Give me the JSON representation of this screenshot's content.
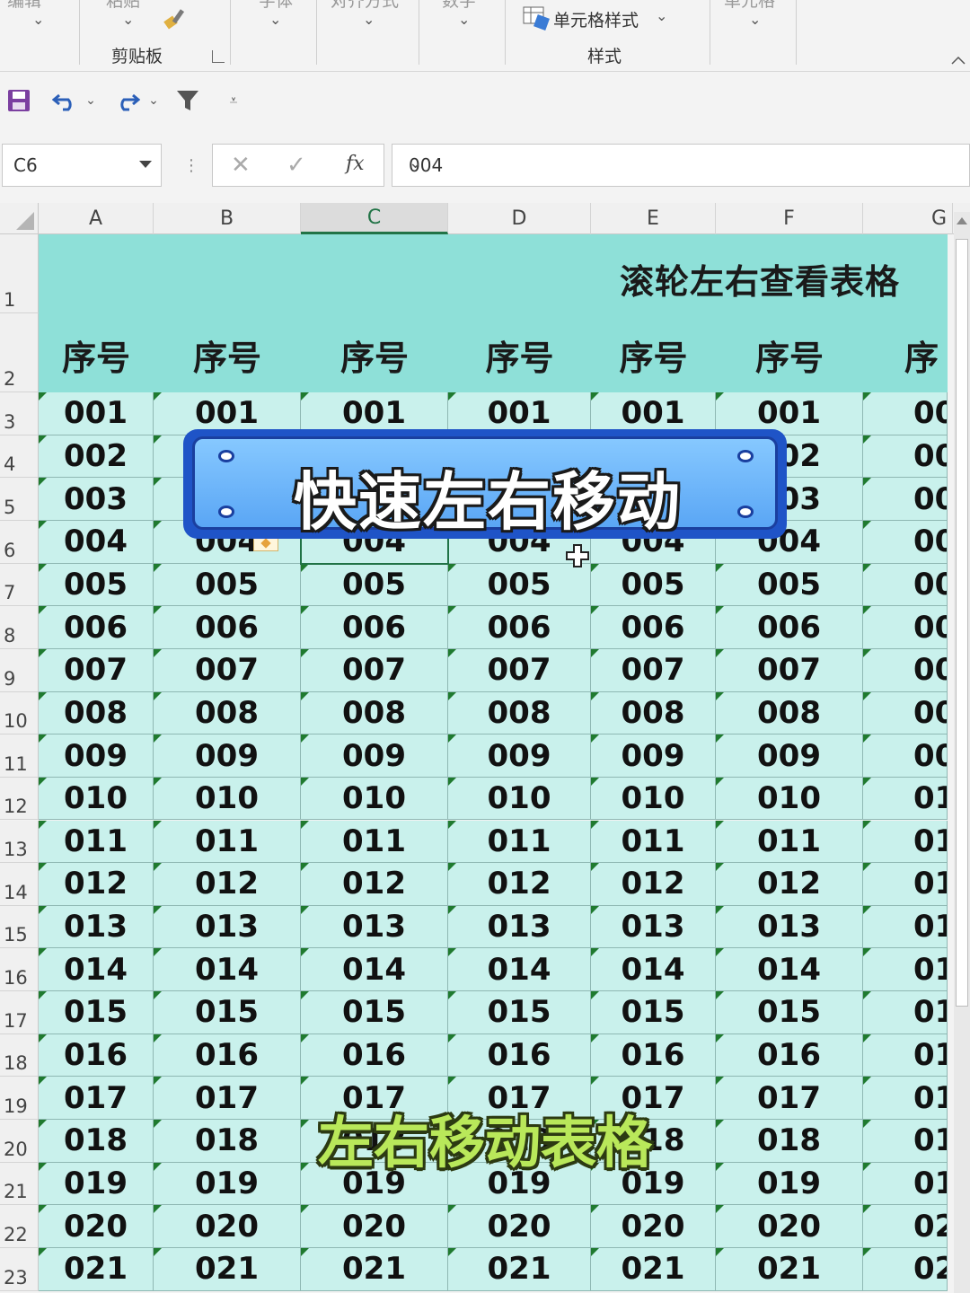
{
  "ribbon": {
    "partial_labels": [
      "编辑",
      "粘贴",
      "字体",
      "对齐方式",
      "数字",
      "单元格"
    ],
    "cell_style": "单元格样式",
    "clipboard": "剪贴板",
    "styles": "样式"
  },
  "namebox": {
    "value": "C6"
  },
  "formula_bar": {
    "fx": "fx",
    "value": "004"
  },
  "columns": [
    "A",
    "B",
    "C",
    "D",
    "E",
    "F",
    "G"
  ],
  "rows": [
    "1",
    "2",
    "3",
    "4",
    "5",
    "6",
    "7",
    "8",
    "9",
    "10",
    "11",
    "12",
    "13",
    "14",
    "15",
    "16",
    "17",
    "18",
    "19",
    "20",
    "21",
    "22",
    "23"
  ],
  "sheet": {
    "title": "滚轮左右查看表格",
    "header": [
      "序号",
      "序号",
      "序号",
      "序号",
      "序号",
      "序号",
      "序"
    ],
    "values": [
      "001",
      "002",
      "003",
      "004",
      "005",
      "006",
      "007",
      "008",
      "009",
      "010",
      "011",
      "012",
      "013",
      "014",
      "015",
      "016",
      "017",
      "018",
      "019",
      "020",
      "021"
    ]
  },
  "overlay": {
    "banner": "快速左右移动",
    "subtitle": "左右移动表格"
  },
  "colors": {
    "header_band": "#8ee0d8",
    "cell_bg": "#c9f1ec",
    "banner": "#1f54c7",
    "subtitle": "#b9e85a",
    "selection": "#217346"
  }
}
